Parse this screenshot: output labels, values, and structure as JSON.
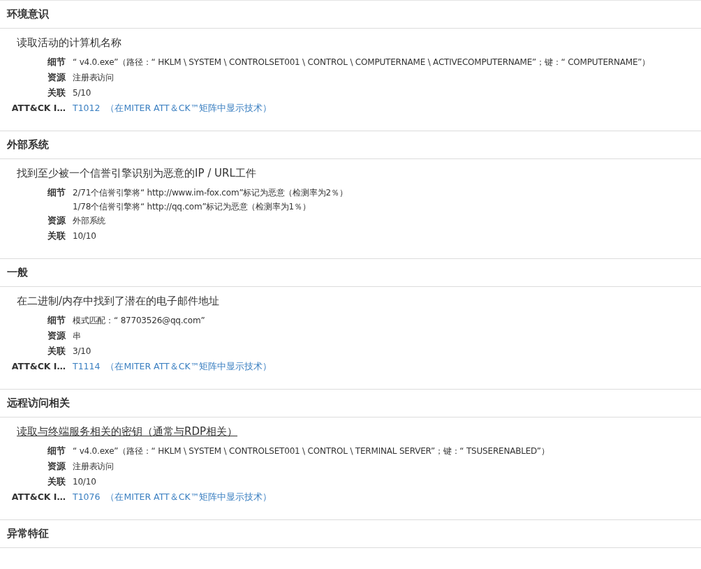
{
  "sections": [
    {
      "title": "环境意识",
      "indicators": [
        {
          "title": "读取活动的计算机名称",
          "hovered": false,
          "rows": [
            {
              "label": "细节",
              "lines": [
                "“ v4.0.exe”（路径：“ HKLM \\ SYSTEM \\ CONTROLSET001 \\ CONTROL \\ COMPUTERNAME \\ ACTIVECOMPUTERNAME”；键：“ COMPUTERNAME”）"
              ]
            },
            {
              "label": "资源",
              "lines": [
                "注册表访问"
              ]
            },
            {
              "label": "关联",
              "lines": [
                "5/10"
              ]
            }
          ],
          "attck": {
            "label": "ATT&CK I…",
            "id": "T1012",
            "link": "（在MITER ATT＆CK™矩阵中显示技术）"
          }
        }
      ]
    },
    {
      "title": "外部系统",
      "indicators": [
        {
          "title": "找到至少被一个信誉引擎识别为恶意的IP / URL工件",
          "hovered": false,
          "rows": [
            {
              "label": "细节",
              "lines": [
                "2/71个信誉引擎将“ http://www.im-fox.com”标记为恶意（检测率为2％）",
                "1/78个信誉引擎将“ http://qq.com”标记为恶意（检测率为1％）"
              ]
            },
            {
              "label": "资源",
              "lines": [
                "外部系统"
              ]
            },
            {
              "label": "关联",
              "lines": [
                "10/10"
              ]
            }
          ]
        }
      ]
    },
    {
      "title": "一般",
      "indicators": [
        {
          "title": "在二进制/内存中找到了潜在的电子邮件地址",
          "hovered": false,
          "rows": [
            {
              "label": "细节",
              "lines": [
                "模式匹配：“ 87703526@qq.com”"
              ]
            },
            {
              "label": "资源",
              "lines": [
                "串"
              ]
            },
            {
              "label": "关联",
              "lines": [
                "3/10"
              ]
            }
          ],
          "attck": {
            "label": "ATT&CK I…",
            "id": "T1114",
            "link": "（在MITER ATT＆CK™矩阵中显示技术）"
          }
        }
      ]
    },
    {
      "title": "远程访问相关",
      "indicators": [
        {
          "title": "读取与终端服务相关的密钥（通常与RDP相关）",
          "hovered": true,
          "rows": [
            {
              "label": "细节",
              "lines": [
                "“ v4.0.exe”（路径：“ HKLM \\ SYSTEM \\ CONTROLSET001 \\ CONTROL \\ TERMINAL SERVER”；键：“ TSUSERENABLED”）"
              ]
            },
            {
              "label": "资源",
              "lines": [
                "注册表访问"
              ]
            },
            {
              "label": "关联",
              "lines": [
                "10/10"
              ]
            }
          ],
          "attck": {
            "label": "ATT&CK I…",
            "id": "T1076",
            "link": "（在MITER ATT＆CK™矩阵中显示技术）"
          }
        }
      ]
    },
    {
      "title": "异常特征"
    }
  ]
}
